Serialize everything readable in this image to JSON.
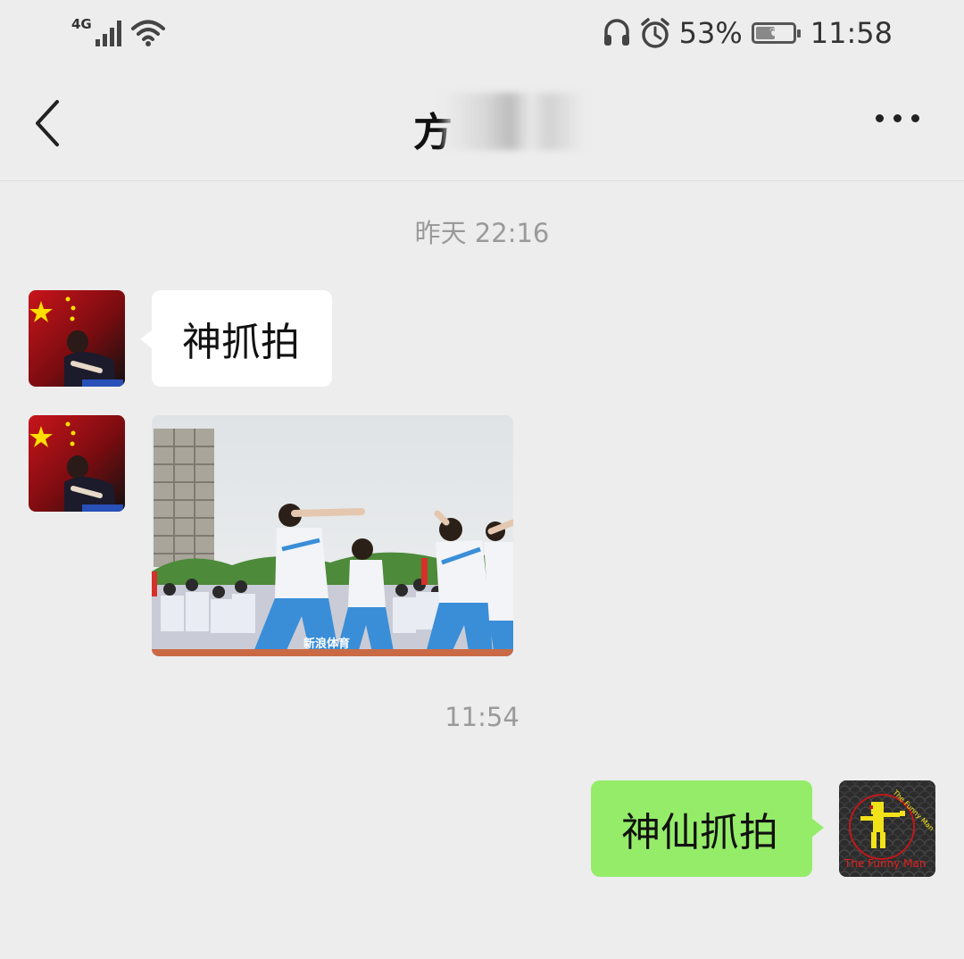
{
  "status_bar": {
    "network": "4G",
    "battery_percent": "53%",
    "battery_level": 0.53,
    "time": "11:58",
    "icons": [
      "signal-icon",
      "wifi-icon",
      "headphone-icon",
      "alarm-icon",
      "battery-icon"
    ]
  },
  "header": {
    "title": "方"
  },
  "messages": [
    {
      "type": "timestamp",
      "text": "昨天 22:16"
    },
    {
      "type": "text",
      "direction": "incoming",
      "text": "神抓拍"
    },
    {
      "type": "image",
      "direction": "incoming",
      "caption_watermark": "新浪体育"
    },
    {
      "type": "timestamp",
      "text": "11:54"
    },
    {
      "type": "text",
      "direction": "outgoing",
      "text": "神仙抓拍"
    }
  ],
  "avatars": {
    "incoming": {
      "icon": "flag-avatar-icon"
    },
    "outgoing": {
      "icon": "funny-man-avatar-icon",
      "text": "The Funny Man"
    }
  },
  "colors": {
    "background": "#ededed",
    "outgoing_bubble": "#95ec69",
    "incoming_bubble": "#ffffff",
    "timestamp": "#9a9a9a"
  }
}
